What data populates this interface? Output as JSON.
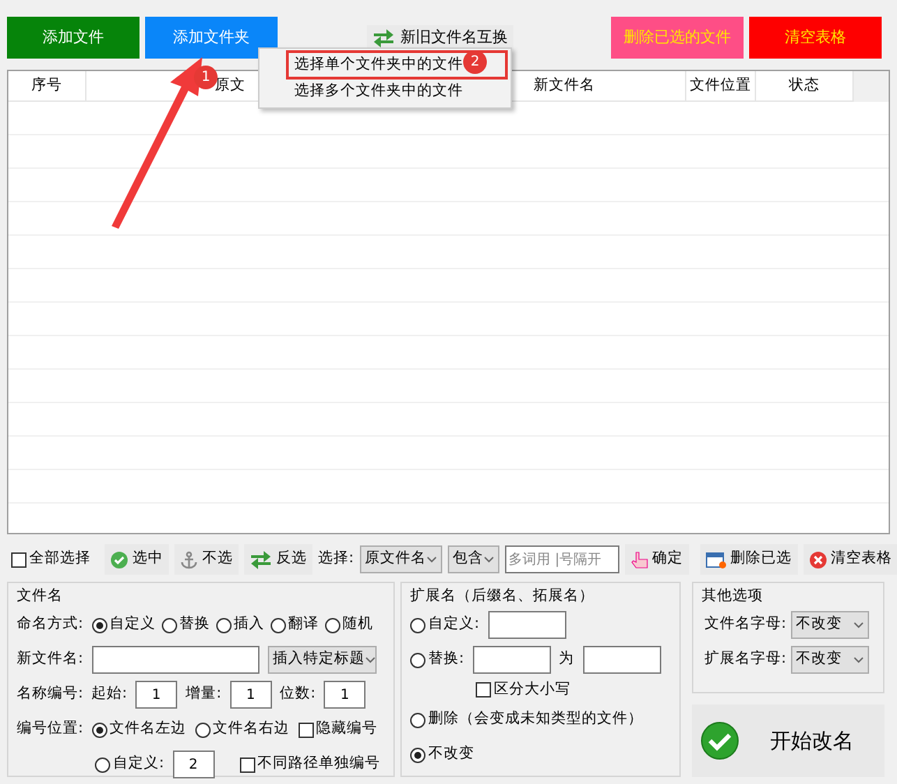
{
  "top_buttons": [
    {
      "label": "添加文件",
      "kind": "green"
    },
    {
      "label": "添加文件夹",
      "kind": "blue"
    },
    {
      "label": "新旧文件名互换",
      "kind": "swap"
    },
    {
      "label": "删除已选的文件",
      "kind": "pink"
    },
    {
      "label": "清空表格",
      "kind": "red"
    }
  ],
  "context_menu": [
    {
      "label": "选择单个文件夹中的文件",
      "highlighted": true
    },
    {
      "label": "选择多个文件夹中的文件",
      "highlighted": false
    }
  ],
  "annotation_badges": [
    "1",
    "2"
  ],
  "table": {
    "columns": [
      "序号",
      "原文",
      "新文件名",
      "文件位置",
      "状态"
    ]
  },
  "toolbar": [
    {
      "kind": "checkbox",
      "label": "全部选择",
      "checked": false
    },
    {
      "kind": "button",
      "label": "选中"
    },
    {
      "kind": "button",
      "label": "不选"
    },
    {
      "kind": "button",
      "label": "反选"
    },
    {
      "kind": "label",
      "label": "选择:"
    },
    {
      "kind": "select",
      "value": "原文件名"
    },
    {
      "kind": "select",
      "value": "包含"
    },
    {
      "kind": "input",
      "placeholder": "多词用 |号隔开"
    },
    {
      "kind": "button",
      "label": "确定"
    },
    {
      "kind": "spacer"
    },
    {
      "kind": "button",
      "label": "删除已选"
    },
    {
      "kind": "button",
      "label": "清空表格"
    }
  ],
  "filename_panel": {
    "title": "文件名",
    "naming_label": "命名方式:",
    "naming_options": [
      {
        "label": "自定义",
        "selected": true
      },
      {
        "label": "替换",
        "selected": false
      },
      {
        "label": "插入",
        "selected": false
      },
      {
        "label": "翻译",
        "selected": false
      },
      {
        "label": "随机",
        "selected": false
      }
    ],
    "new_name_label": "新文件名:",
    "insert_select": "插入特定标题",
    "numbering_label": "名称编号:",
    "numbering_fields": [
      {
        "label": "起始:",
        "value": "1"
      },
      {
        "label": "增量:",
        "value": "1"
      },
      {
        "label": "位数:",
        "value": "1"
      }
    ],
    "position_label": "编号位置:",
    "position_options": [
      {
        "label": "文件名左边",
        "selected": true
      },
      {
        "label": "文件名右边",
        "selected": false
      },
      {
        "label": "自定义:",
        "selected": false
      }
    ],
    "custom_value": "2",
    "hide_number": {
      "label": "隐藏编号",
      "checked": false
    },
    "separate_number": {
      "label": "不同路径单独编号",
      "checked": false
    }
  },
  "extension_panel": {
    "title": "扩展名（后缀名、拓展名）",
    "custom": {
      "label": "自定义:",
      "selected": false
    },
    "replace": {
      "label": "替换:",
      "selected": false,
      "joiner": "为"
    },
    "case_sensitive": {
      "label": "区分大小写",
      "checked": false
    },
    "delete": {
      "label": "删除（会变成未知类型的文件）",
      "selected": false
    },
    "unchanged": {
      "label": "不改变",
      "selected": true
    }
  },
  "other_options": {
    "title": "其他选项",
    "rows": [
      {
        "label": "文件名字母:",
        "value": "不改变"
      },
      {
        "label": "扩展名字母:",
        "value": "不改变"
      }
    ]
  },
  "start_button": "开始改名"
}
